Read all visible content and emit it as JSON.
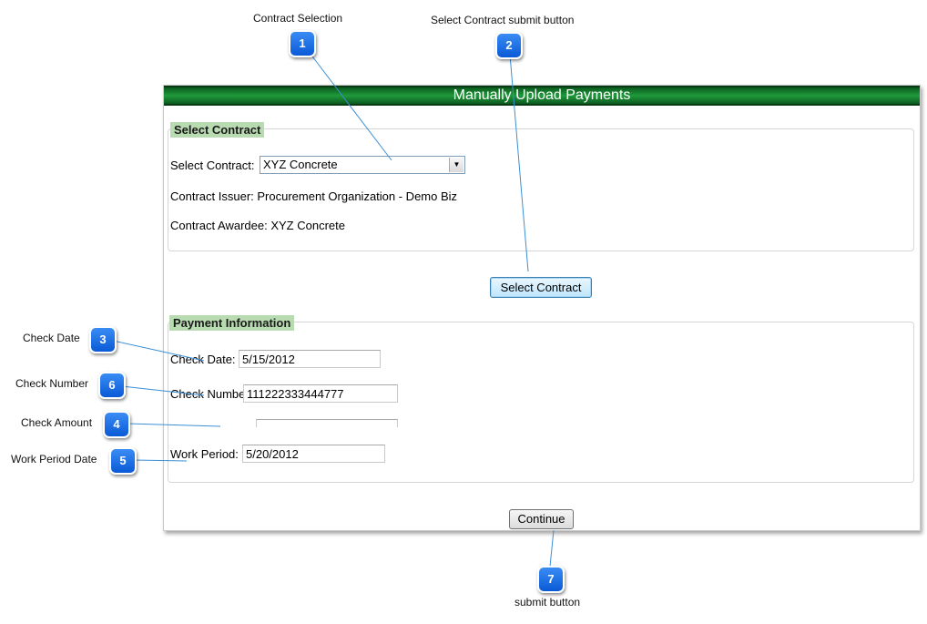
{
  "panel": {
    "title": "Manually Upload Payments",
    "select_contract_section": {
      "legend": "Select Contract",
      "select_label": "Select Contract:",
      "select_value": "XYZ Concrete",
      "issuer_label": "Contract Issuer:",
      "issuer_value": "Procurement Organization - Demo Biz",
      "awardee_label": "Contract Awardee:",
      "awardee_value": "XYZ Concrete"
    },
    "select_contract_button": "Select Contract",
    "payment_section": {
      "legend": "Payment Information",
      "check_date_label": "Check Date:",
      "check_date_value": "5/15/2012",
      "check_number_label": "Check Number:",
      "check_number_value": "111222333444777",
      "work_period_label": "Work Period:",
      "work_period_value": "5/20/2012"
    },
    "continue_button": "Continue"
  },
  "callouts": [
    {
      "number": "1",
      "label": "Contract Selection"
    },
    {
      "number": "2",
      "label": "Select Contract submit button"
    },
    {
      "number": "3",
      "label": "Check Date"
    },
    {
      "number": "6",
      "label": "Check Number"
    },
    {
      "number": "4",
      "label": "Check Amount"
    },
    {
      "number": "5",
      "label": "Work Period Date"
    },
    {
      "number": "7",
      "label": "submit button"
    }
  ],
  "colors": {
    "header_green": "#1f9a3b",
    "legend_green": "#b9dbb2",
    "callout_blue": "#1a6fe6",
    "leader_line": "#3b8fd6"
  }
}
